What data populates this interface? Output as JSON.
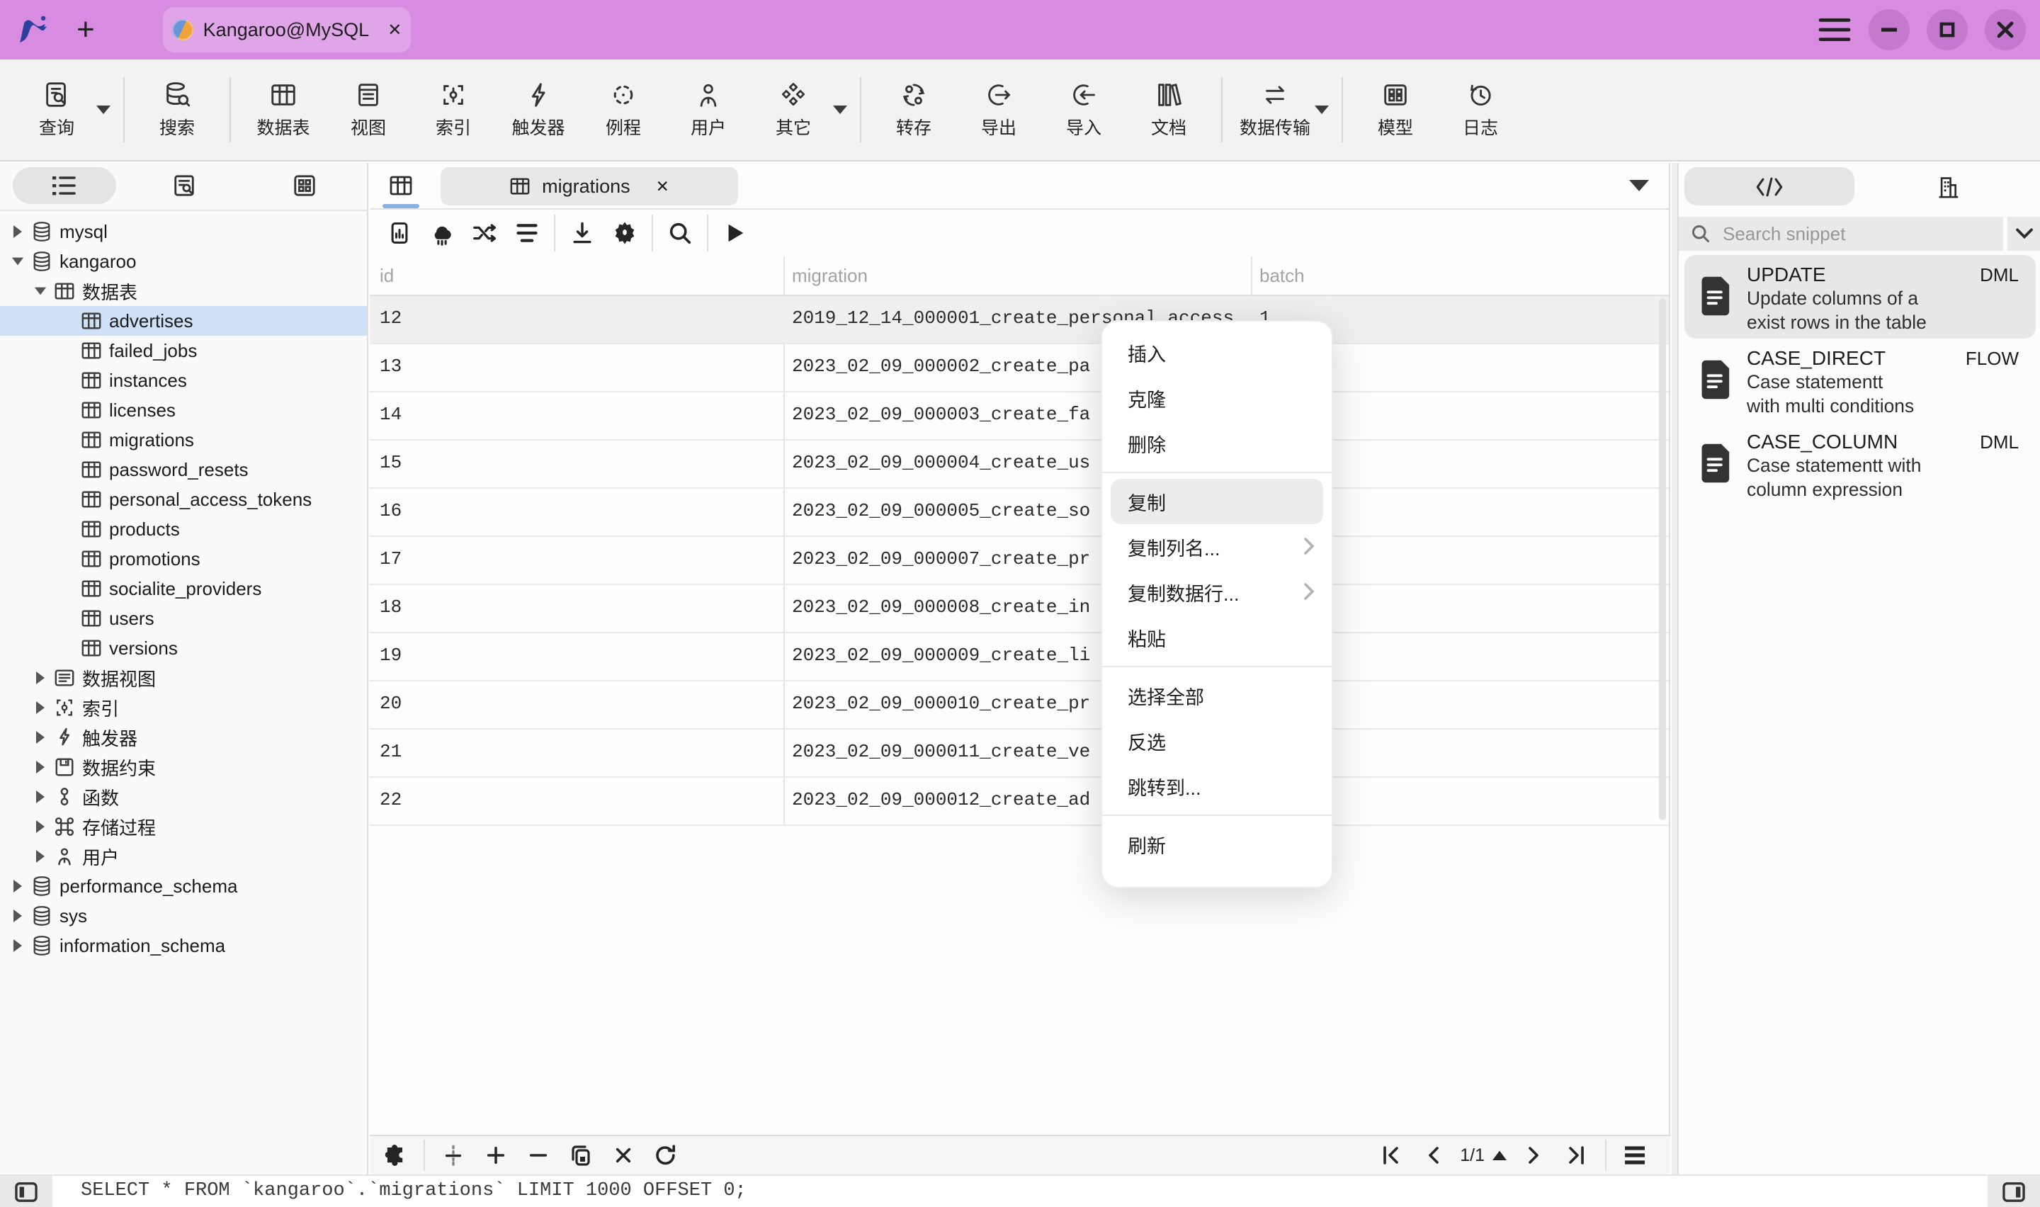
{
  "colors": {
    "titlebar_bg": "#d88ce1",
    "titlebar_tab_bg": "#dfa5e8",
    "sidebar_selection": "#cfe1f7",
    "tab_underline": "#8ab1e0",
    "selected_row_bg": "#efefef",
    "menu_highlight": "#ececec",
    "toolbar_bg": "#f2f2f2"
  },
  "titlebar": {
    "tab_label": "Kangaroo@MySQL"
  },
  "toolbar": {
    "items": [
      {
        "label": "查询",
        "icon": "query-icon",
        "dropdown": true
      },
      {
        "label": "搜索",
        "icon": "search-db-icon",
        "dropdown": false
      },
      {
        "label": "数据表",
        "icon": "tables-icon",
        "dropdown": false
      },
      {
        "label": "视图",
        "icon": "views-icon",
        "dropdown": false
      },
      {
        "label": "索引",
        "icon": "index-icon",
        "dropdown": false
      },
      {
        "label": "触发器",
        "icon": "trigger-icon",
        "dropdown": false
      },
      {
        "label": "例程",
        "icon": "routine-icon",
        "dropdown": false
      },
      {
        "label": "用户",
        "icon": "user-icon",
        "dropdown": false
      },
      {
        "label": "其它",
        "icon": "others-icon",
        "dropdown": true
      },
      {
        "label": "转存",
        "icon": "dump-icon",
        "dropdown": false
      },
      {
        "label": "导出",
        "icon": "export-icon",
        "dropdown": false
      },
      {
        "label": "导入",
        "icon": "import-icon",
        "dropdown": false
      },
      {
        "label": "文档",
        "icon": "docs-icon",
        "dropdown": false
      },
      {
        "label": "数据传输",
        "icon": "transfer-icon",
        "dropdown": true
      },
      {
        "label": "模型",
        "icon": "model-icon",
        "dropdown": false
      },
      {
        "label": "日志",
        "icon": "log-icon",
        "dropdown": false
      }
    ]
  },
  "sidebar": {
    "tabs": [
      "list-view-icon",
      "object-search-icon",
      "grid-view-icon"
    ],
    "tree": [
      {
        "label": "mysql"
      },
      {
        "label": "kangaroo"
      },
      {
        "label": "数据表"
      },
      {
        "label": "advertises"
      },
      {
        "label": "failed_jobs"
      },
      {
        "label": "instances"
      },
      {
        "label": "licenses"
      },
      {
        "label": "migrations"
      },
      {
        "label": "password_resets"
      },
      {
        "label": "personal_access_tokens"
      },
      {
        "label": "products"
      },
      {
        "label": "promotions"
      },
      {
        "label": "socialite_providers"
      },
      {
        "label": "users"
      },
      {
        "label": "versions"
      },
      {
        "label": "数据视图"
      },
      {
        "label": "索引"
      },
      {
        "label": "触发器"
      },
      {
        "label": "数据约束"
      },
      {
        "label": "函数"
      },
      {
        "label": "存储过程"
      },
      {
        "label": "用户"
      },
      {
        "label": "performance_schema"
      },
      {
        "label": "sys"
      },
      {
        "label": "information_schema"
      }
    ]
  },
  "main": {
    "tab_label": "migrations",
    "table": {
      "columns": [
        "id",
        "migration",
        "batch"
      ],
      "rows": [
        {
          "id": "12",
          "migration": "2019_12_14_000001_create_personal_access",
          "batch": "1"
        },
        {
          "id": "13",
          "migration": "2023_02_09_000002_create_pa",
          "batch": ""
        },
        {
          "id": "14",
          "migration": "2023_02_09_000003_create_fa",
          "batch": ""
        },
        {
          "id": "15",
          "migration": "2023_02_09_000004_create_us",
          "batch": ""
        },
        {
          "id": "16",
          "migration": "2023_02_09_000005_create_so",
          "batch": ""
        },
        {
          "id": "17",
          "migration": "2023_02_09_000007_create_pr",
          "batch": ""
        },
        {
          "id": "18",
          "migration": "2023_02_09_000008_create_in",
          "batch": ""
        },
        {
          "id": "19",
          "migration": "2023_02_09_000009_create_li",
          "batch": ""
        },
        {
          "id": "20",
          "migration": "2023_02_09_000010_create_pr",
          "batch": ""
        },
        {
          "id": "21",
          "migration": "2023_02_09_000011_create_ve",
          "batch": ""
        },
        {
          "id": "22",
          "migration": "2023_02_09_000012_create_ad",
          "batch": ""
        }
      ]
    },
    "pagination": {
      "page": "1/1"
    }
  },
  "context_menu": {
    "items": [
      {
        "label": "插入"
      },
      {
        "label": "克隆"
      },
      {
        "label": "删除"
      },
      {
        "label": "复制",
        "highlighted": true
      },
      {
        "label": "复制列名...",
        "submenu": true
      },
      {
        "label": "复制数据行...",
        "submenu": true
      },
      {
        "label": "粘贴"
      },
      {
        "label": "选择全部"
      },
      {
        "label": "反选"
      },
      {
        "label": "跳转到..."
      },
      {
        "label": "刷新"
      }
    ]
  },
  "right_panel": {
    "tabs": [
      "code-snippet-icon",
      "building-icon"
    ],
    "search_placeholder": "Search snippet",
    "snippets": [
      {
        "title": "UPDATE",
        "tag": "DML",
        "desc1": "Update columns of a",
        "desc2": "exist rows in the table",
        "selected": true
      },
      {
        "title": "CASE_DIRECT",
        "tag": "FLOW",
        "desc1": "Case statementt",
        "desc2": "with multi conditions",
        "selected": false
      },
      {
        "title": "CASE_COLUMN",
        "tag": "DML",
        "desc1": "Case statementt with",
        "desc2": "column expression",
        "selected": false
      }
    ]
  },
  "status_bar": {
    "sql": "SELECT * FROM `kangaroo`.`migrations` LIMIT 1000 OFFSET 0;"
  }
}
